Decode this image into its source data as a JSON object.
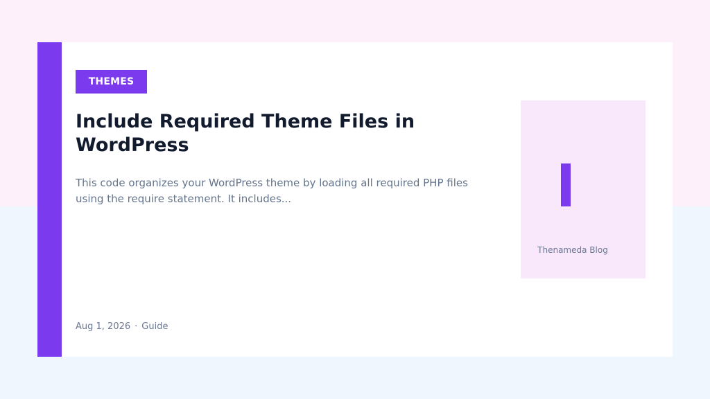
{
  "card": {
    "category": "THEMES",
    "title": "Include Required Theme Files in WordPress",
    "excerpt": "This code organizes your WordPress theme by loading all required PHP files using the require statement. It includes...",
    "meta": {
      "date": "Aug 1, 2026",
      "separator": "·",
      "type": "Guide"
    },
    "thumbnail": {
      "label": "Thenameda Blog"
    }
  },
  "colors": {
    "accent": "#7b3aed",
    "title_text": "#121a2e",
    "muted_text": "#64748b",
    "background_top": "#fdf0fb",
    "background_bottom": "#eff6fe",
    "thumbnail_bg": "#f9e7fc",
    "card_bg": "#ffffff"
  }
}
